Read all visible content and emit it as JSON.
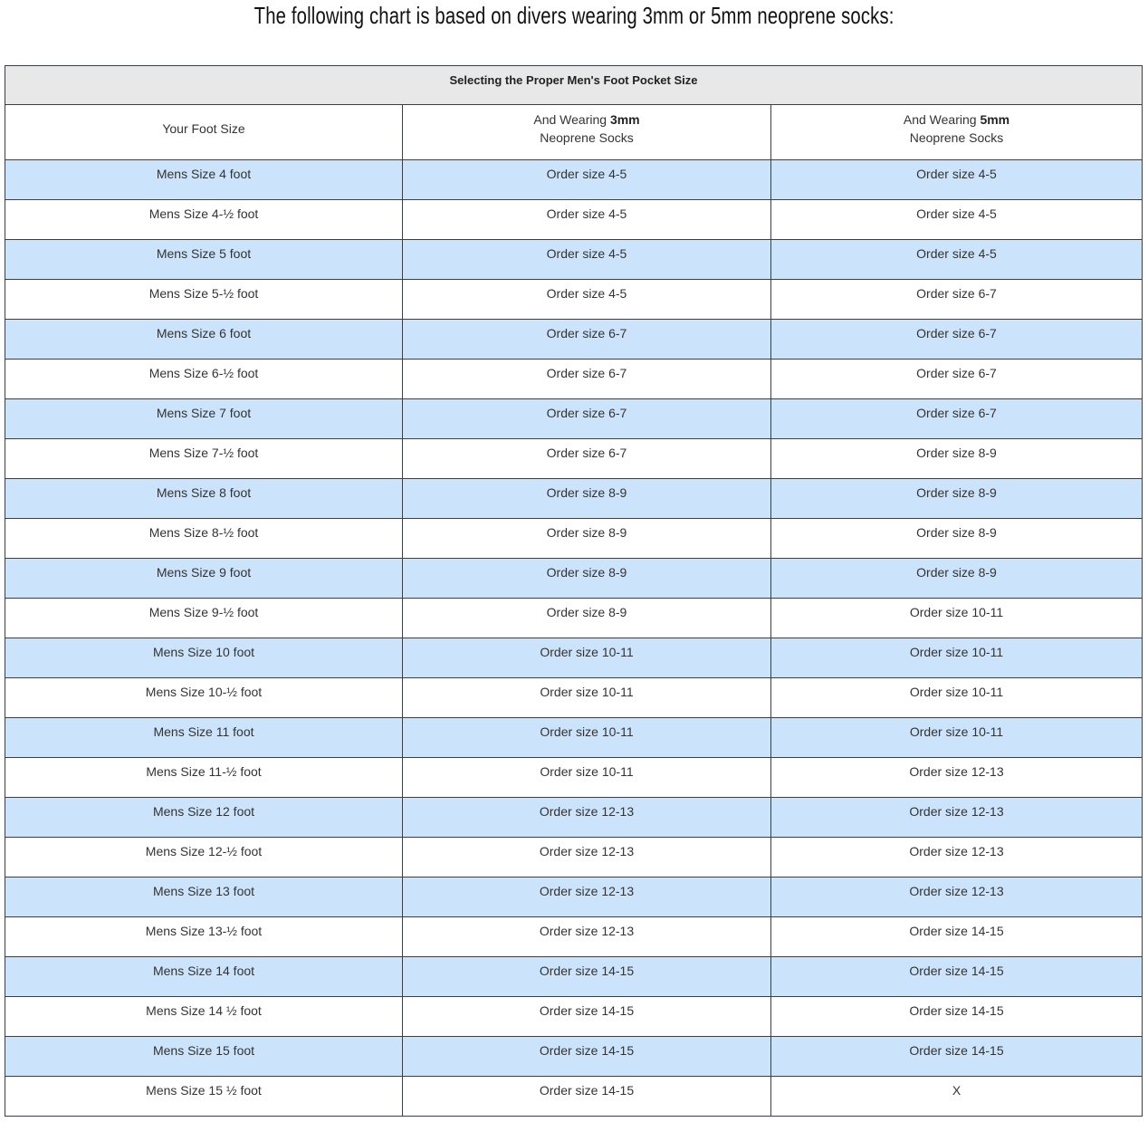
{
  "title": "The following chart is based on divers wearing 3mm or 5mm neoprene socks:",
  "table": {
    "caption": "Selecting the Proper Men's Foot Pocket Size",
    "headers": {
      "foot": "Your Foot Size",
      "col3_prefix": "And Wearing ",
      "col3_bold": "3mm",
      "col3_suffix": "Neoprene Socks",
      "col5_prefix": "And Wearing ",
      "col5_bold": "5mm",
      "col5_suffix": "Neoprene Socks"
    },
    "rows": [
      [
        "Mens Size 4 foot",
        "Order size 4-5",
        "Order size 4-5"
      ],
      [
        "Mens Size 4-½ foot",
        "Order size 4-5",
        "Order size 4-5"
      ],
      [
        "Mens Size 5 foot",
        "Order size 4-5",
        "Order size 4-5"
      ],
      [
        "Mens Size 5-½ foot",
        "Order size 4-5",
        "Order size 6-7"
      ],
      [
        "Mens Size 6 foot",
        "Order size 6-7",
        "Order size 6-7"
      ],
      [
        "Mens Size 6-½ foot",
        "Order size 6-7",
        "Order size 6-7"
      ],
      [
        "Mens Size 7 foot",
        "Order size 6-7",
        "Order size 6-7"
      ],
      [
        "Mens Size 7-½ foot",
        "Order size 6-7",
        "Order size 8-9"
      ],
      [
        "Mens Size 8 foot",
        "Order size 8-9",
        "Order size 8-9"
      ],
      [
        "Mens Size 8-½ foot",
        "Order size 8-9",
        "Order size 8-9"
      ],
      [
        "Mens Size 9 foot",
        "Order size 8-9",
        "Order size 8-9"
      ],
      [
        "Mens Size 9-½ foot",
        "Order size 8-9",
        "Order size 10-11"
      ],
      [
        "Mens Size 10 foot",
        "Order size 10-11",
        "Order size 10-11"
      ],
      [
        "Mens Size 10-½ foot",
        "Order size 10-11",
        "Order size 10-11"
      ],
      [
        "Mens Size 11 foot",
        "Order size 10-11",
        "Order size 10-11"
      ],
      [
        "Mens Size 11-½ foot",
        "Order size 10-11",
        "Order size 12-13"
      ],
      [
        "Mens Size 12 foot",
        "Order size 12-13",
        "Order size 12-13"
      ],
      [
        "Mens Size 12-½ foot",
        "Order size 12-13",
        "Order size 12-13"
      ],
      [
        "Mens Size 13 foot",
        "Order size 12-13",
        "Order size 12-13"
      ],
      [
        "Mens Size 13-½ foot",
        "Order size 12-13",
        "Order size 14-15"
      ],
      [
        "Mens Size 14 foot",
        "Order size 14-15",
        "Order size 14-15"
      ],
      [
        "Mens Size 14 ½ foot",
        "Order size 14-15",
        "Order size 14-15"
      ],
      [
        "Mens Size 15 foot",
        "Order size 14-15",
        "Order size 14-15"
      ],
      [
        "Mens Size 15 ½ foot",
        "Order size 14-15",
        "X"
      ]
    ],
    "colors": {
      "stripe": "#cce4fb",
      "caption_bg": "#e8e8e8",
      "border": "#3a3f45"
    }
  }
}
